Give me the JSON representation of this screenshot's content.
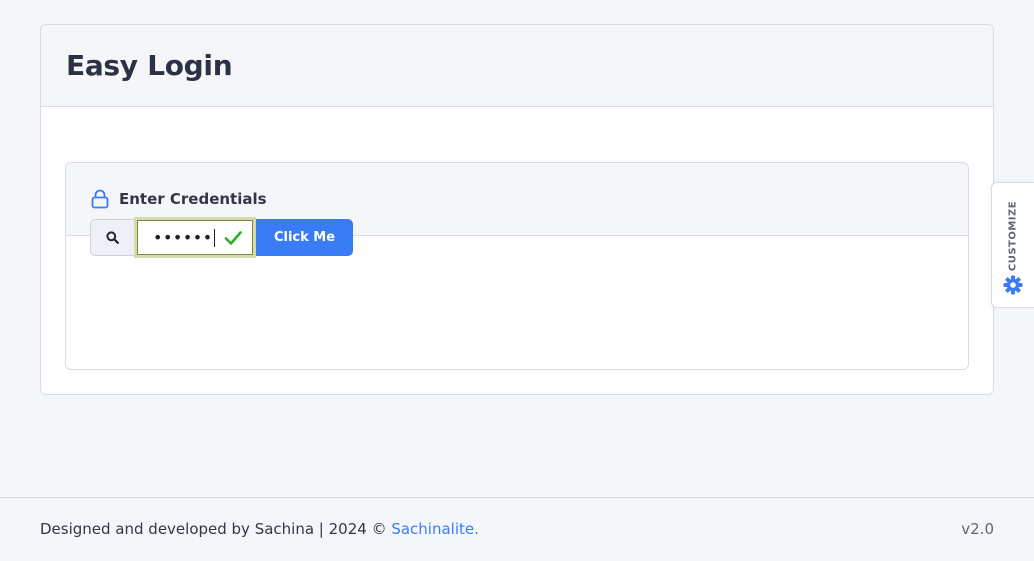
{
  "page": {
    "title": "Easy Login"
  },
  "credentials": {
    "title": "Enter Credentials",
    "lock_icon": "lock-icon",
    "search_icon": "search-icon",
    "password_value": "••••••",
    "check_icon": "check-icon",
    "button_label": "Click Me"
  },
  "customize": {
    "label": "CUSTOMIZE",
    "icon": "gear-icon"
  },
  "footer": {
    "text": "Designed and developed by Sachina | 2024 © ",
    "link": "Sachinalite.",
    "version": "v2.0"
  },
  "colors": {
    "accent": "#3a7cf6",
    "success": "#2bb31d",
    "background": "#f5f6f9",
    "border": "#d8dce4"
  }
}
